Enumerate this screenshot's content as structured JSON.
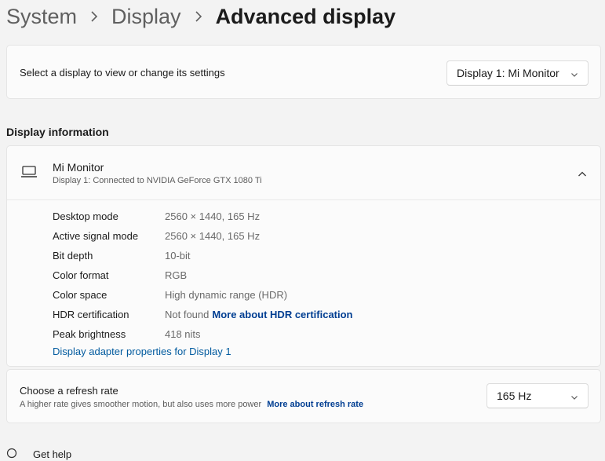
{
  "breadcrumb": {
    "items": [
      "System",
      "Display"
    ],
    "current": "Advanced display"
  },
  "select_display": {
    "label": "Select a display to view or change its settings",
    "selected": "Display 1: Mi Monitor"
  },
  "display_info": {
    "section_title": "Display information",
    "monitor_name": "Mi Monitor",
    "monitor_sub": "Display 1: Connected to NVIDIA GeForce GTX 1080 Ti",
    "rows": [
      {
        "label": "Desktop mode",
        "value": "2560 × 1440, 165 Hz"
      },
      {
        "label": "Active signal mode",
        "value": "2560 × 1440, 165 Hz"
      },
      {
        "label": "Bit depth",
        "value": "10-bit"
      },
      {
        "label": "Color format",
        "value": "RGB"
      },
      {
        "label": "Color space",
        "value": "High dynamic range (HDR)"
      },
      {
        "label": "HDR certification",
        "value": "Not found",
        "link": "More about HDR certification"
      },
      {
        "label": "Peak brightness",
        "value": "418 nits"
      }
    ],
    "adapter_link": "Display adapter properties for Display 1"
  },
  "refresh": {
    "title": "Choose a refresh rate",
    "subtitle": "A higher rate gives smoother motion, but also uses more power",
    "link": "More about refresh rate",
    "selected": "165 Hz"
  },
  "help": {
    "label": "Get help"
  },
  "colors": {
    "accent_link": "#003e92",
    "card_bg": "#fbfbfb",
    "page_bg": "#f3f3f3"
  }
}
